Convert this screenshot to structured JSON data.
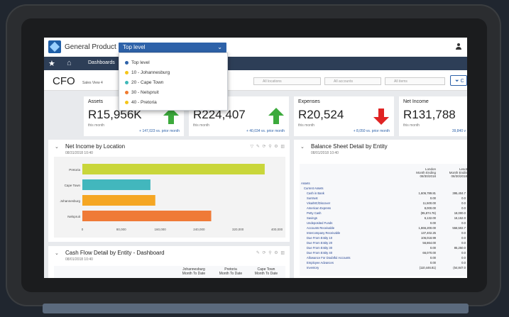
{
  "app": {
    "product": "General Product",
    "level": "Top level",
    "level_options": [
      {
        "label": "Top level",
        "color": "#2e62a9"
      },
      {
        "label": "10 - Johannesburg",
        "color": "#f5c518"
      },
      {
        "label": "20 - Cape Town",
        "color": "#3fb8b8"
      },
      {
        "label": "30 - Nelspruit",
        "color": "#f07a2e"
      },
      {
        "label": "40 - Pretoria",
        "color": "#f5c518"
      }
    ]
  },
  "nav": {
    "tab": "Dashboards"
  },
  "header": {
    "title": "CFO",
    "view": "Sales View 4",
    "filters": [
      "All locations",
      "All accounts",
      "All items"
    ],
    "filter_button": "C"
  },
  "kpis": [
    {
      "label": "Assets",
      "value": "R15,956K",
      "sub": "this month",
      "prior": "+ 147,023 vs. prior month",
      "trend": "up"
    },
    {
      "label": "",
      "value": "R224,407",
      "sub": "this month",
      "prior": "+ 40,034 vs. prior month",
      "trend": "up"
    },
    {
      "label": "Expenses",
      "value": "R20,524",
      "sub": "this month",
      "prior": "+ 8,050 vs. prior month",
      "trend": "down"
    },
    {
      "label": "Net Income",
      "value": "R131,788",
      "sub": "this month",
      "prior": "39,840 v",
      "trend": ""
    }
  ],
  "panels": {
    "net_income": {
      "title": "Net Income by Location",
      "date": "08/31/2018 10:40"
    },
    "balance": {
      "title": "Balance Sheet Detail by Entity",
      "date": "08/01/2018 10:40"
    },
    "cashflow": {
      "title": "Cash Flow Detail by Entity - Dashboard",
      "date": "08/01/2018 10:40"
    }
  },
  "chart_data": {
    "type": "bar",
    "orientation": "horizontal",
    "categories": [
      "Pretoria",
      "Cape Town",
      "Johannesburg",
      "Nelspruit"
    ],
    "values": [
      375000,
      140000,
      150000,
      265000
    ],
    "colors": [
      "#c9d63a",
      "#42b7bd",
      "#f5a623",
      "#ef7a37"
    ],
    "xlim": [
      0,
      400000
    ],
    "xticks": [
      "0",
      "80,000",
      "160,000",
      "240,000",
      "320,000",
      "400,000"
    ]
  },
  "balance_sheet": {
    "col1": [
      "London",
      "Month Ending",
      "08/30/2018"
    ],
    "col2": [
      "Lesot",
      "Month Endin",
      "08/30/2018"
    ],
    "rows": [
      {
        "label": "Assets",
        "v1": "",
        "v2": ""
      },
      {
        "label": "Current Assets",
        "v1": "",
        "v2": ""
      },
      {
        "label": "Cash in Bank",
        "v1": "1,606,789.81",
        "v2": "395,404.7"
      },
      {
        "label": "Suntrust",
        "v1": "0.00",
        "v2": "0.0"
      },
      {
        "label": "Visa/MC/Discover",
        "v1": "11,500.00",
        "v2": "0.0"
      },
      {
        "label": "American Express",
        "v1": "8,000.00",
        "v2": "0.0"
      },
      {
        "label": "Petty Cash",
        "v1": "(95,874.76)",
        "v2": "18,000.0"
      },
      {
        "label": "Savings",
        "v1": "6,132.00",
        "v2": "16,152.0"
      },
      {
        "label": "Undeposited Funds",
        "v1": "0.00",
        "v2": "0.0"
      },
      {
        "label": "Accounts Receivable",
        "v1": "1,866,200.00",
        "v2": "556,502.7"
      },
      {
        "label": "Intercompany Receivable",
        "v1": "137,402.25",
        "v2": "0.0"
      },
      {
        "label": "Due From Entity 10",
        "v1": "106,018.99",
        "v2": "0.0"
      },
      {
        "label": "Due From Entity 20",
        "v1": "56,864.00",
        "v2": "0.0"
      },
      {
        "label": "Due From Entity 30",
        "v1": "0.00",
        "v2": "85,250.0"
      },
      {
        "label": "Due From Entity 40",
        "v1": "66,070.00",
        "v2": "0.0"
      },
      {
        "label": "Allowance For Doubtful Accounts",
        "v1": "0.00",
        "v2": "0.0"
      },
      {
        "label": "Employee Advances",
        "v1": "0.00",
        "v2": "0.0"
      },
      {
        "label": "Inventory",
        "v1": "(110,446.81)",
        "v2": "(54,847.0"
      }
    ]
  },
  "cashflow": {
    "columns": [
      [
        "Johannesburg",
        "Month To Date"
      ],
      [
        "Pretoria",
        "Month To Date"
      ],
      [
        "Cape Town",
        "Month To Date"
      ]
    ]
  }
}
